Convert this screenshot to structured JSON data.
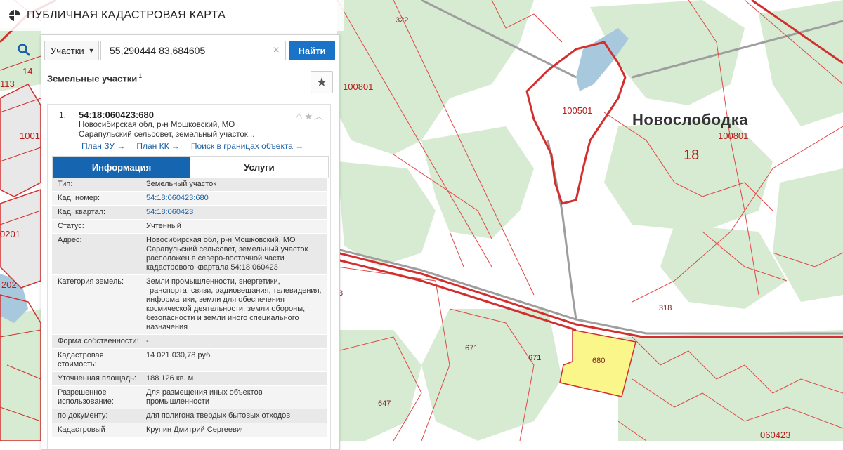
{
  "app": {
    "title": "ПУБЛИЧНАЯ КАДАСТРОВАЯ КАРТА"
  },
  "search": {
    "type_label": "Участки",
    "query": "55,290444 83,684605",
    "find_label": "Найти"
  },
  "results": {
    "title": "Земельные участки",
    "count": "1",
    "item": {
      "index": "1.",
      "cad_number": "54:18:060423:680",
      "address_short": "Новосибирская обл, р-н Мошковский, МО Сарапульский сельсовет, земельный участок...",
      "links": [
        "План ЗУ →",
        "План КК →",
        "Поиск в границах объекта →"
      ],
      "tabs": [
        "Информация",
        "Услуги"
      ],
      "info": [
        {
          "key": "Тип:",
          "value": "Земельный участок",
          "link": false
        },
        {
          "key": "Кад. номер:",
          "value": "54:18:060423:680",
          "link": true
        },
        {
          "key": "Кад. квартал:",
          "value": "54:18:060423",
          "link": true
        },
        {
          "key": "Статус:",
          "value": "Учтенный",
          "link": false
        },
        {
          "key": "Адрес:",
          "value": "Новосибирская обл, р-н Мошковский, МО Сарапульский сельсовет, земельный участок расположен в северо-восточной части кадастрового квартала 54:18:060423",
          "link": false
        },
        {
          "key": "Категория земель:",
          "value": "Земли промышленности, энергетики, транспорта, связи, радиовещания, телевидения, информатики, земли для обеспечения космической деятельности, земли обороны, безопасности и земли иного специального назначения",
          "link": false
        },
        {
          "key": "Форма собственности:",
          "value": "-",
          "link": false
        },
        {
          "key": "Кадастровая стоимость:",
          "value": "14 021 030,78 руб.",
          "link": false
        },
        {
          "key": "Уточненная площадь:",
          "value": "188 126 кв. м",
          "link": false
        },
        {
          "key": "Разрешенное использование:",
          "value": "Для размещения иных объектов промышленности",
          "link": false
        },
        {
          "key": "по документу:",
          "value": "для полигона твердых бытовых отходов",
          "link": false
        },
        {
          "key": "Кадастровый",
          "value": "Крупин Дмитрий Сергеевич",
          "link": false
        }
      ]
    }
  },
  "map": {
    "town_label": "Новослободка",
    "labels": [
      "322",
      "100801",
      "100501",
      "100801",
      "18",
      "318",
      "671",
      "671",
      "680",
      "647",
      "060423",
      "14",
      "113",
      "1001",
      "0201",
      "202",
      "3"
    ]
  },
  "colors": {
    "accent": "#1a73c7",
    "tab_active": "#1565b0",
    "parcel_border": "#d32f2f",
    "selected_fill": "#fbf68a",
    "green_area": "#d9ecd4"
  }
}
